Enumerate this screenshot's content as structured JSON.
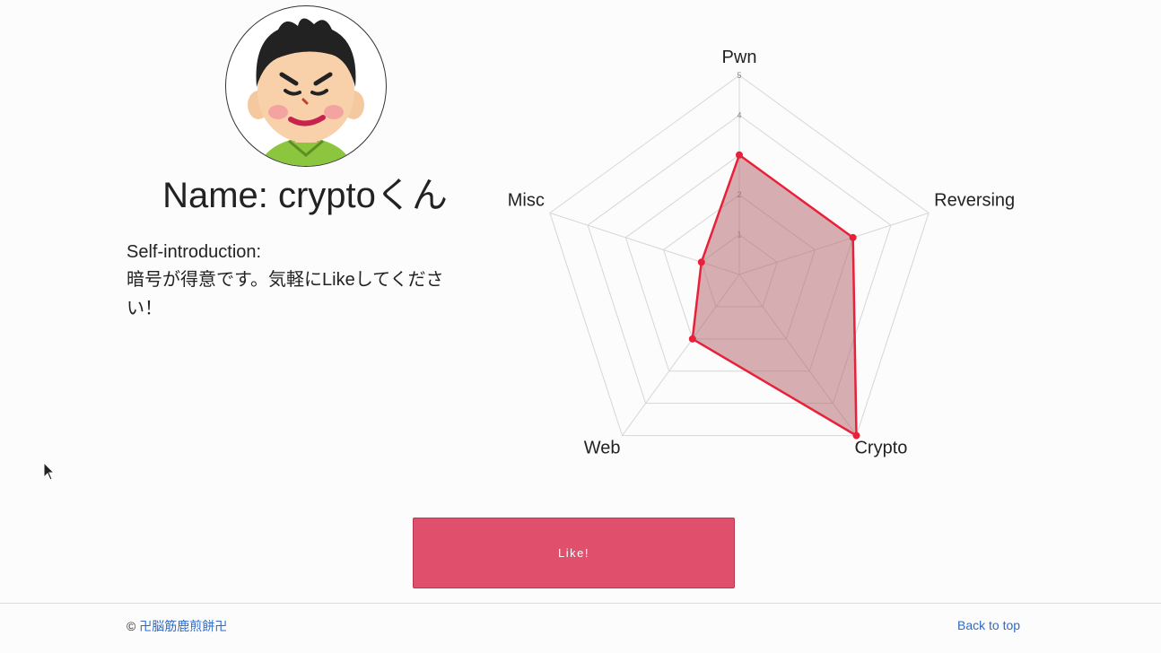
{
  "profile": {
    "name": "Name: cryptoくん",
    "intro_label": "Self-introduction:",
    "intro_text": "暗号が得意です。気軽にLikeしてください！"
  },
  "chart_data": {
    "type": "radar",
    "axes": [
      "Pwn",
      "Reversing",
      "Crypto",
      "Web",
      "Misc"
    ],
    "values": [
      3,
      3,
      5,
      2,
      1
    ],
    "rmax": 5,
    "ticks": [
      "1",
      "2",
      "3",
      "4",
      "5"
    ],
    "colors": {
      "line": "#e8213a",
      "fill": "#b76b72",
      "grid": "#d6d6d6"
    }
  },
  "like_button": {
    "label": "Like!"
  },
  "footer": {
    "copyright_symbol": "©",
    "author": "卍脳筋鹿煎餅卍",
    "back_to_top": "Back to top"
  },
  "colors": {
    "link": "#2d6bc9",
    "button": "#e0506c"
  }
}
